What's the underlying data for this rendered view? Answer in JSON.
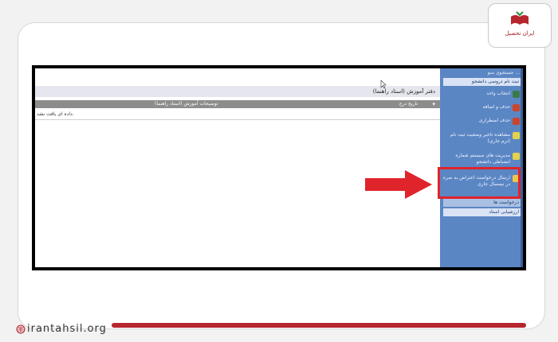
{
  "brand": {
    "logo_text": "ایران تحصیل",
    "footer_site": "irantahsil.org"
  },
  "content": {
    "title": "دفتر آموزش (استاد راهنما)",
    "columns": [
      "توضیحات آموزش (استاد راهنما)",
      "تاریخ درج"
    ],
    "empty_message": "داده ای یافت نشد."
  },
  "sidebar": {
    "search_placeholder": "جستجوی منو ...",
    "header1": "ثبت نام دروسی دانشجو",
    "items": [
      {
        "label": "انتخاب واحد",
        "icon": "pencil-icon"
      },
      {
        "label": "حذف و اضافه",
        "icon": "tools-icon"
      },
      {
        "label": "حذف اضطراری",
        "icon": "pencil-icon"
      },
      {
        "label": "مشاهده تاخیر وضعیت ثبت نام (ترم جاری)",
        "icon": "warning-icon"
      },
      {
        "label": "مدیریت های سیستم شماره انضباطی دانشجو",
        "icon": "document-icon"
      },
      {
        "label": "ارسال درخواست اعتراض به نمره در نیمسال جاری",
        "icon": "document-icon"
      }
    ],
    "header2": "درخواست ها",
    "header3": "ارزشیابی استاد"
  },
  "colors": {
    "accent_red": "#e0242b",
    "sidebar_blue": "#5b86c4"
  }
}
